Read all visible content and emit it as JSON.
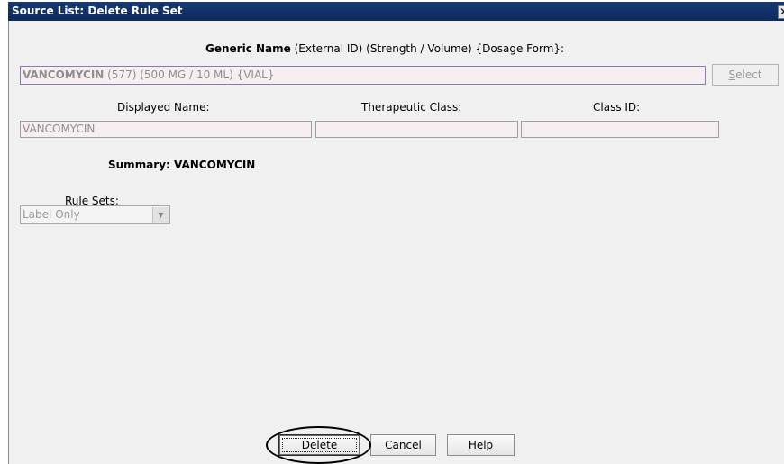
{
  "window": {
    "title": "Source List: Delete Rule Set",
    "close_glyph": "✕"
  },
  "generic": {
    "label_bold": "Generic Name",
    "label_rest": " (External ID)  (Strength / Volume)  {Dosage Form}:",
    "value_bold": "VANCOMYCIN",
    "value_rest": " (577) (500 MG / 10 ML) {VIAL}",
    "select_button": {
      "prefix": "",
      "mnemonic": "S",
      "suffix": "elect"
    }
  },
  "fields": {
    "displayed_name": {
      "label": "Displayed Name:",
      "value": "VANCOMYCIN"
    },
    "therapeutic_class": {
      "label": "Therapeutic Class:",
      "value": ""
    },
    "class_id": {
      "label": "Class ID:",
      "value": ""
    }
  },
  "summary": {
    "label": "Summary: VANCOMYCIN"
  },
  "rule_sets": {
    "label": "Rule Sets:",
    "selected": "Label Only"
  },
  "buttons": {
    "delete": {
      "mnemonic": "D",
      "suffix": "elete"
    },
    "cancel": {
      "mnemonic": "C",
      "suffix": "ancel"
    },
    "help": {
      "mnemonic": "H",
      "suffix": "elp"
    }
  },
  "colors": {
    "titlebar": "#0b2a60",
    "client": "#f0f0f0",
    "field_bg": "#f6eeef",
    "field_border_highlight": "#8a7bb8"
  },
  "icons": {
    "close": "close-icon",
    "dropdown": "chevron-down-icon"
  }
}
